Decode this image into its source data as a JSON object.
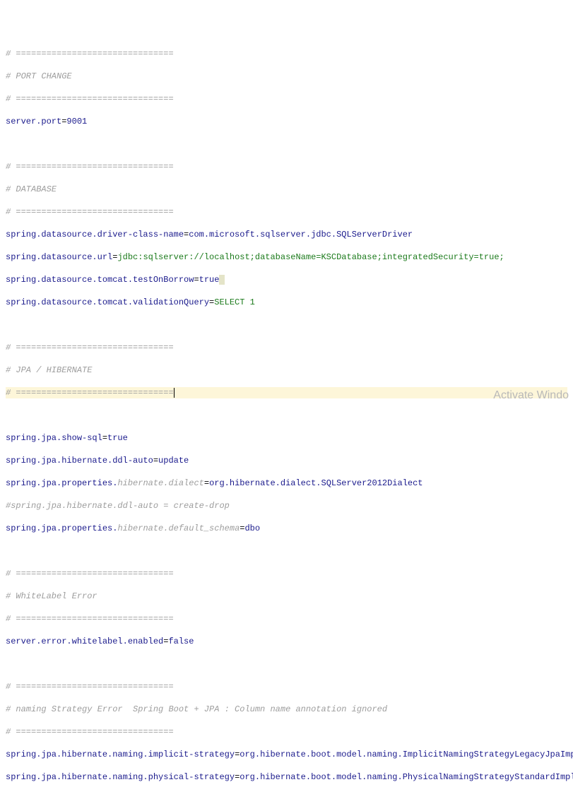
{
  "section_port": {
    "sep": "# ===============================",
    "title": "# PORT CHANGE",
    "key": "server.port",
    "val": "9001"
  },
  "section_db": {
    "sep": "# ===============================",
    "title": "# DATABASE",
    "k1": "spring.datasource.driver-class-name",
    "v1": "com.microsoft.sqlserver.jdbc.SQLServerDriver",
    "k2": "spring.datasource.url",
    "v2": "jdbc:sqlserver://localhost;databaseName=KSCDatabase;integratedSecurity=true;",
    "k3": "spring.datasource.tomcat.testOnBorrow",
    "v3": "true",
    "k4": "spring.datasource.tomcat.validationQuery",
    "v4": "SELECT 1"
  },
  "section_jpa": {
    "sep": "# ===============================",
    "title": "# JPA / HIBERNATE",
    "k1": "spring.jpa.show-sql",
    "v1": "true",
    "k2a": "spring.jpa.hibernate.ddl-auto",
    "v2a": "update",
    "k2": "spring.jpa.properties.",
    "k2i": "hibernate.dialect",
    "v2": "org.hibernate.dialect.SQLServer2012Dialect",
    "comment": "#spring.jpa.hibernate.ddl-auto = create-drop",
    "k3": "spring.jpa.properties.",
    "k3i": "hibernate.default_schema",
    "v3": "dbo"
  },
  "section_wl": {
    "sep": "# ===============================",
    "title": "# WhiteLabel Error",
    "k1": "server.error.whitelabel.enabled",
    "v1": "false"
  },
  "section_naming": {
    "sep": "# ===============================",
    "title": "# naming Strategy Error  Spring Boot + JPA : Column name annotation ignored",
    "k1": "spring.jpa.hibernate.naming.implicit-strategy",
    "v1": "org.hibernate.boot.model.naming.ImplicitNamingStrategyLegacyJpaImpl",
    "k2": "spring.jpa.hibernate.naming.physical-strategy",
    "v2": "org.hibernate.boot.model.naming.PhysicalNamingStrategyStandardImpl"
  },
  "eq": "=",
  "watermark": "Activate Windo"
}
